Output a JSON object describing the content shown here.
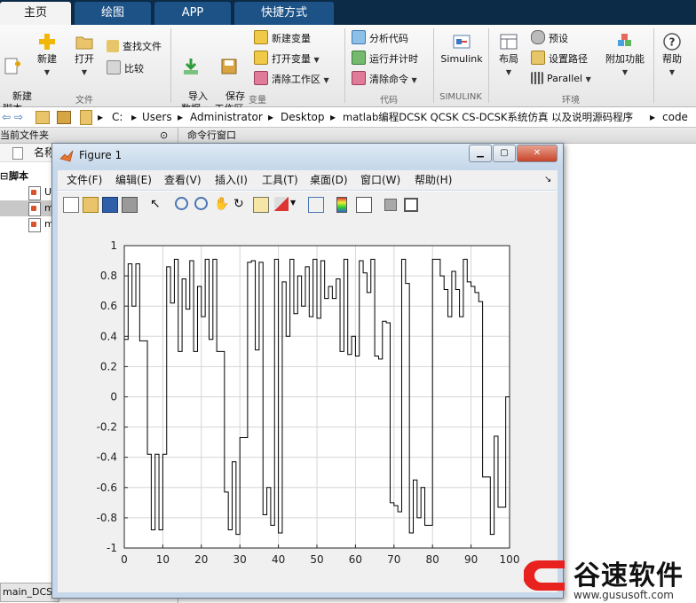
{
  "ribbon_tabs": [
    "主页",
    "绘图",
    "APP",
    "快捷方式"
  ],
  "ribbon": {
    "file": {
      "new_script": "新建\n脚本",
      "new": "新建",
      "open": "打开",
      "find_files": "查找文件",
      "compare": "比较",
      "group_label": "文件"
    },
    "variable": {
      "import_data": "导入\n数据",
      "save_workspace": "保存\n工作区",
      "new_variable": "新建变量",
      "open_variable": "打开变量",
      "clear_workspace": "清除工作区",
      "group_label": "变量"
    },
    "code": {
      "analyze_code": "分析代码",
      "run_and_time": "运行并计时",
      "clear_commands": "清除命令",
      "group_label": "代码"
    },
    "simulink": {
      "simulink": "Simulink",
      "group_label": "SIMULINK"
    },
    "environment": {
      "layout": "布局",
      "preferences": "预设",
      "set_path": "设置路径",
      "parallel": "Parallel",
      "add_ons": "附加功能",
      "group_label": "环境"
    },
    "help": {
      "help": "帮助"
    }
  },
  "address_bar": {
    "segments": [
      "C:",
      "Users",
      "Administrator",
      "Desktop",
      "matlab编程DCSK QCSK CS-DCSK系统仿真 以及说明源码程序",
      "code"
    ]
  },
  "left_panel": {
    "title": "当前文件夹",
    "column_name": "名称",
    "section": "脚本",
    "items": [
      "U",
      "m",
      "m"
    ],
    "bottom_tab": "main_DCSK"
  },
  "command_window": {
    "title": "命令行窗口"
  },
  "figure": {
    "title": "Figure 1",
    "menu": [
      "文件(F)",
      "编辑(E)",
      "查看(V)",
      "插入(I)",
      "工具(T)",
      "桌面(D)",
      "窗口(W)",
      "帮助(H)"
    ],
    "toolbar_icons": [
      "new-figure-icon",
      "open-file-icon",
      "save-icon",
      "print-icon",
      "pointer-icon",
      "zoom-in-icon",
      "zoom-out-icon",
      "pan-icon",
      "rotate-icon",
      "data-cursor-icon",
      "brush-icon",
      "link-icon",
      "colorbar-icon",
      "legend-icon",
      "hide-plot-tools-icon",
      "show-plot-tools-icon"
    ]
  },
  "chart_data": {
    "type": "line",
    "style": "stairs",
    "title": "",
    "xlabel": "",
    "ylabel": "",
    "xlim": [
      0,
      100
    ],
    "ylim": [
      -1,
      1
    ],
    "xticks": [
      0,
      10,
      20,
      30,
      40,
      50,
      60,
      70,
      80,
      90,
      100
    ],
    "yticks": [
      -1,
      -0.8,
      -0.6,
      -0.4,
      -0.2,
      0,
      0.2,
      0.4,
      0.6,
      0.8,
      1
    ],
    "grid": true,
    "color": "#000000",
    "x": [
      0,
      1,
      2,
      3,
      4,
      5,
      6,
      7,
      8,
      9,
      10,
      11,
      12,
      13,
      14,
      15,
      16,
      17,
      18,
      19,
      20,
      21,
      22,
      23,
      24,
      25,
      26,
      27,
      28,
      29,
      30,
      31,
      32,
      33,
      34,
      35,
      36,
      37,
      38,
      39,
      40,
      41,
      42,
      43,
      44,
      45,
      46,
      47,
      48,
      49,
      50,
      51,
      52,
      53,
      54,
      55,
      56,
      57,
      58,
      59,
      60,
      61,
      62,
      63,
      64,
      65,
      66,
      67,
      68,
      69,
      70,
      71,
      72,
      73,
      74,
      75,
      76,
      77,
      78,
      79,
      80,
      81,
      82,
      83,
      84,
      85,
      86,
      87,
      88,
      89,
      90,
      91,
      92,
      93,
      94,
      95,
      96,
      97,
      98,
      99,
      100
    ],
    "values": [
      0.38,
      0.88,
      0.6,
      0.88,
      0.37,
      0.37,
      -0.38,
      -0.88,
      -0.38,
      -0.88,
      -0.38,
      0.86,
      0.62,
      0.91,
      0.3,
      0.78,
      0.58,
      0.9,
      0.3,
      0.73,
      0.53,
      0.91,
      0.38,
      0.91,
      0.3,
      0.3,
      -0.63,
      -0.88,
      -0.43,
      -0.91,
      -0.27,
      -0.27,
      0.89,
      0.9,
      0.31,
      0.89,
      -0.78,
      -0.6,
      -0.85,
      0.91,
      -0.9,
      0.76,
      0.4,
      0.91,
      0.55,
      0.8,
      0.6,
      0.86,
      0.53,
      0.91,
      0.52,
      0.9,
      0.65,
      0.73,
      0.65,
      0.78,
      0.3,
      0.91,
      0.28,
      0.4,
      0.27,
      0.9,
      0.82,
      0.69,
      0.91,
      0.27,
      0.25,
      0.5,
      0.49,
      -0.7,
      -0.72,
      -0.76,
      0.91,
      0.75,
      -0.9,
      -0.55,
      -0.8,
      -0.6,
      -0.85,
      -0.85,
      0.91,
      0.91,
      0.8,
      0.71,
      0.53,
      0.83,
      0.71,
      0.53,
      0.91,
      0.76,
      0.73,
      0.69,
      0.63,
      -0.53,
      -0.53,
      -0.91,
      -0.26,
      -0.73,
      -0.73,
      0.0,
      0.0
    ]
  },
  "watermark": {
    "brand": "谷速软件",
    "url": "www.gususoft.com",
    "brand_color": "#e8231f"
  }
}
